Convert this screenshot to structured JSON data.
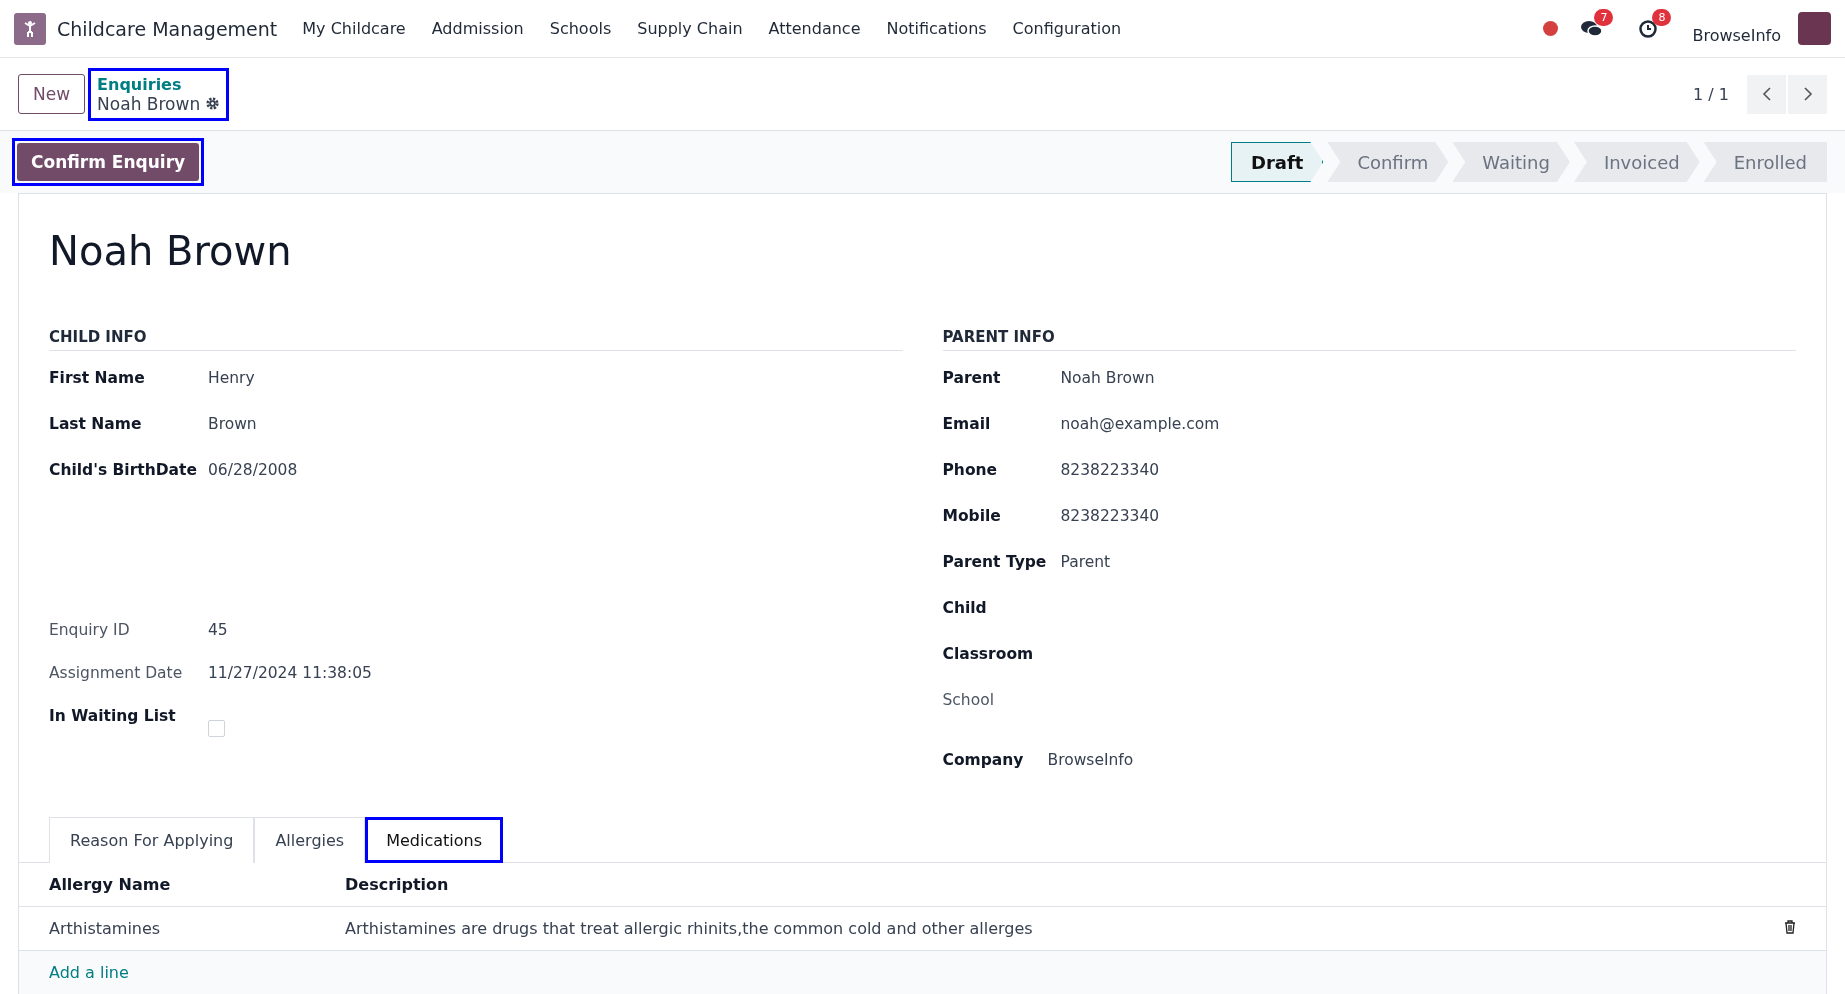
{
  "navbar": {
    "app_name": "Childcare Management",
    "menu": [
      "My Childcare",
      "Addmission",
      "Schools",
      "Supply Chain",
      "Attendance",
      "Notifications",
      "Configuration"
    ],
    "message_count": "7",
    "activity_count": "8",
    "company": "BrowseInfo"
  },
  "control_panel": {
    "new_button": "New",
    "breadcrumb": {
      "parent": "Enquiries",
      "current": "Noah Brown",
      "highlighted": true
    },
    "pager": "1 / 1"
  },
  "confirm_button": {
    "label": "Confirm Enquiry",
    "highlighted": true
  },
  "stages": [
    {
      "label": "Draft",
      "selected": true
    },
    {
      "label": "Confirm",
      "selected": false
    },
    {
      "label": "Waiting",
      "selected": false
    },
    {
      "label": "Invoiced",
      "selected": false
    },
    {
      "label": "Enrolled",
      "selected": false
    }
  ],
  "record_title": "Noah Brown",
  "child_info": {
    "title": "CHILD INFO",
    "fields": [
      {
        "label": "First Name",
        "required": true,
        "value": "Henry"
      },
      {
        "label": "Last Name",
        "required": true,
        "value": "Brown"
      },
      {
        "label": "Child's BirthDate",
        "required": true,
        "value": "06/28/2008"
      }
    ]
  },
  "enquiry_details": {
    "fields": [
      {
        "label": "Enquiry ID",
        "required": false,
        "kind": "text",
        "value": "45"
      },
      {
        "label": "Assignment Date",
        "required": false,
        "kind": "text",
        "value": "11/27/2024 11:38:05"
      },
      {
        "label": "In Waiting List",
        "required": true,
        "kind": "checkbox",
        "checked": false
      }
    ]
  },
  "parent_info": {
    "title": "PARENT INFO",
    "fields": [
      {
        "label": "Parent",
        "required": true,
        "value": "Noah Brown"
      },
      {
        "label": "Email",
        "required": true,
        "value": "noah@example.com"
      },
      {
        "label": "Phone",
        "required": true,
        "value": "8238223340"
      },
      {
        "label": "Mobile",
        "required": true,
        "value": "8238223340"
      },
      {
        "label": "Parent Type",
        "required": true,
        "value": "Parent"
      },
      {
        "label": "Child",
        "required": true
      },
      {
        "label": "Classroom",
        "required": true
      },
      {
        "label": "School",
        "required": false
      }
    ]
  },
  "company_field": {
    "label": "Company",
    "value": "BrowseInfo"
  },
  "tabs": [
    {
      "label": "Reason For Applying",
      "selected": false,
      "highlighted": false
    },
    {
      "label": "Allergies",
      "selected": false,
      "highlighted": false
    },
    {
      "label": "Medications",
      "selected": true,
      "highlighted": true
    }
  ],
  "table": {
    "columns": [
      "Allergy Name",
      "Description"
    ],
    "rows": [
      [
        "Arthistamines",
        "Arthistamines are drugs that treat allergic rhinits,the common cold and other allerges"
      ]
    ],
    "add_line": "Add a line"
  }
}
